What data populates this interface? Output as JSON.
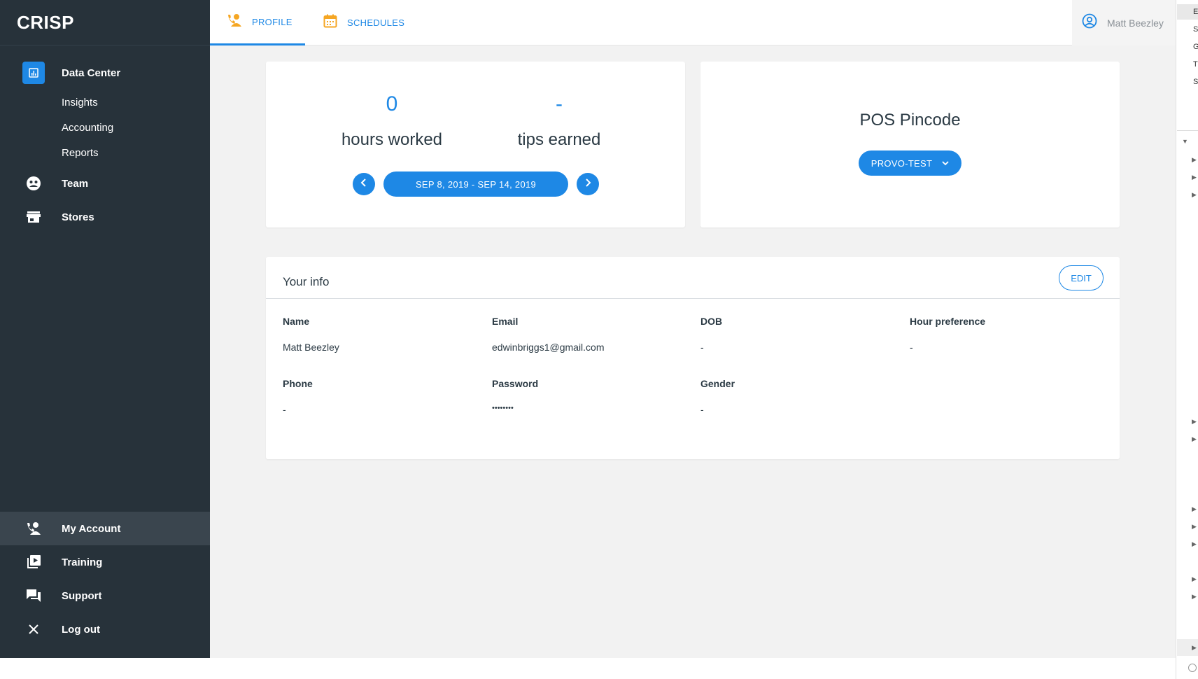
{
  "app": {
    "logo": "CRISP"
  },
  "sidebar": {
    "data_center": "Data Center",
    "sub_items": [
      "Insights",
      "Accounting",
      "Reports"
    ],
    "team": "Team",
    "stores": "Stores",
    "my_account": "My Account",
    "training": "Training",
    "support": "Support",
    "logout": "Log out"
  },
  "tabs": {
    "profile": "PROFILE",
    "schedules": "SCHEDULES"
  },
  "user": {
    "name": "Matt Beezley"
  },
  "stats": {
    "hours_value": "0",
    "hours_label": "hours worked",
    "tips_value": "-",
    "tips_label": "tips earned",
    "date_range": "SEP 8, 2019 - SEP 14, 2019"
  },
  "pos": {
    "title": "POS Pincode",
    "store": "PROVO-TEST"
  },
  "info": {
    "title": "Your info",
    "edit_label": "EDIT",
    "fields": [
      {
        "label": "Name",
        "value": "Matt Beezley"
      },
      {
        "label": "Email",
        "value": "edwinbriggs1@gmail.com"
      },
      {
        "label": "DOB",
        "value": "-"
      },
      {
        "label": "Hour preference",
        "value": "-"
      },
      {
        "label": "Phone",
        "value": "-"
      },
      {
        "label": "Password",
        "value": "••••••••"
      },
      {
        "label": "Gender",
        "value": "-"
      }
    ]
  },
  "right_strip": {
    "letters": [
      "E",
      "S",
      "G",
      "T",
      "S"
    ]
  },
  "colors": {
    "accent": "#1e88e5",
    "sidebar": "#27323a",
    "orange": "#f5a623"
  }
}
